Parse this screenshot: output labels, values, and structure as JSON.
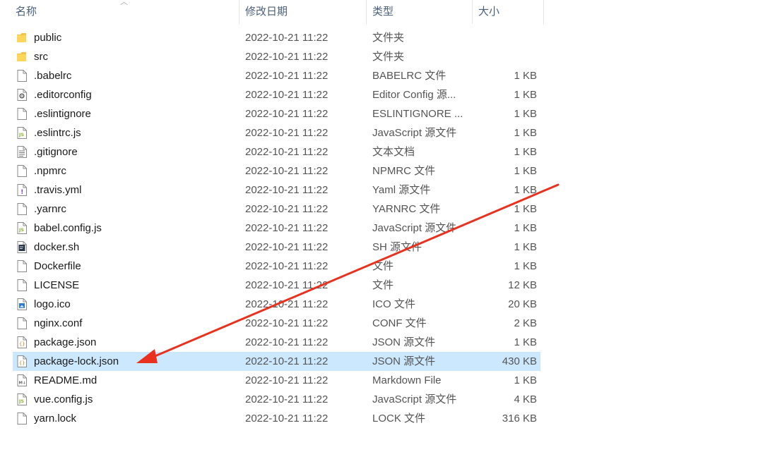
{
  "columns": {
    "name": "名称",
    "date": "修改日期",
    "type": "类型",
    "size": "大小"
  },
  "files": [
    {
      "name": "public",
      "date": "2022-10-21 11:22",
      "type": "文件夹",
      "size": "",
      "icon": "folder-icon"
    },
    {
      "name": "src",
      "date": "2022-10-21 11:22",
      "type": "文件夹",
      "size": "",
      "icon": "folder-icon"
    },
    {
      "name": ".babelrc",
      "date": "2022-10-21 11:22",
      "type": "BABELRC 文件",
      "size": "1 KB",
      "icon": "file-icon"
    },
    {
      "name": ".editorconfig",
      "date": "2022-10-21 11:22",
      "type": "Editor Config 源...",
      "size": "1 KB",
      "icon": "gear-file-icon"
    },
    {
      "name": ".eslintignore",
      "date": "2022-10-21 11:22",
      "type": "ESLINTIGNORE ...",
      "size": "1 KB",
      "icon": "file-icon"
    },
    {
      "name": ".eslintrc.js",
      "date": "2022-10-21 11:22",
      "type": "JavaScript 源文件",
      "size": "1 KB",
      "icon": "js-file-icon"
    },
    {
      "name": ".gitignore",
      "date": "2022-10-21 11:22",
      "type": "文本文档",
      "size": "1 KB",
      "icon": "text-file-icon"
    },
    {
      "name": ".npmrc",
      "date": "2022-10-21 11:22",
      "type": "NPMRC 文件",
      "size": "1 KB",
      "icon": "file-icon"
    },
    {
      "name": ".travis.yml",
      "date": "2022-10-21 11:22",
      "type": "Yaml 源文件",
      "size": "1 KB",
      "icon": "yaml-file-icon"
    },
    {
      "name": ".yarnrc",
      "date": "2022-10-21 11:22",
      "type": "YARNRC 文件",
      "size": "1 KB",
      "icon": "file-icon"
    },
    {
      "name": "babel.config.js",
      "date": "2022-10-21 11:22",
      "type": "JavaScript 源文件",
      "size": "1 KB",
      "icon": "js-file-icon"
    },
    {
      "name": "docker.sh",
      "date": "2022-10-21 11:22",
      "type": "SH 源文件",
      "size": "1 KB",
      "icon": "shell-file-icon"
    },
    {
      "name": "Dockerfile",
      "date": "2022-10-21 11:22",
      "type": "文件",
      "size": "1 KB",
      "icon": "file-icon"
    },
    {
      "name": "LICENSE",
      "date": "2022-10-21 11:22",
      "type": "文件",
      "size": "12 KB",
      "icon": "file-icon"
    },
    {
      "name": "logo.ico",
      "date": "2022-10-21 11:22",
      "type": "ICO 文件",
      "size": "20 KB",
      "icon": "image-file-icon"
    },
    {
      "name": "nginx.conf",
      "date": "2022-10-21 11:22",
      "type": "CONF 文件",
      "size": "2 KB",
      "icon": "file-icon"
    },
    {
      "name": "package.json",
      "date": "2022-10-21 11:22",
      "type": "JSON 源文件",
      "size": "1 KB",
      "icon": "json-file-icon"
    },
    {
      "name": "package-lock.json",
      "date": "2022-10-21 11:22",
      "type": "JSON 源文件",
      "size": "430 KB",
      "icon": "json-file-icon",
      "selected": true
    },
    {
      "name": "README.md",
      "date": "2022-10-21 11:22",
      "type": "Markdown File",
      "size": "1 KB",
      "icon": "markdown-file-icon"
    },
    {
      "name": "vue.config.js",
      "date": "2022-10-21 11:22",
      "type": "JavaScript 源文件",
      "size": "4 KB",
      "icon": "js-file-icon"
    },
    {
      "name": "yarn.lock",
      "date": "2022-10-21 11:22",
      "type": "LOCK 文件",
      "size": "316 KB",
      "icon": "file-icon"
    }
  ],
  "colors": {
    "selection": "#cce8ff",
    "folder": "#f4c34a",
    "annotation_arrow": "#e8321f",
    "js_badge": "#8fb338"
  }
}
